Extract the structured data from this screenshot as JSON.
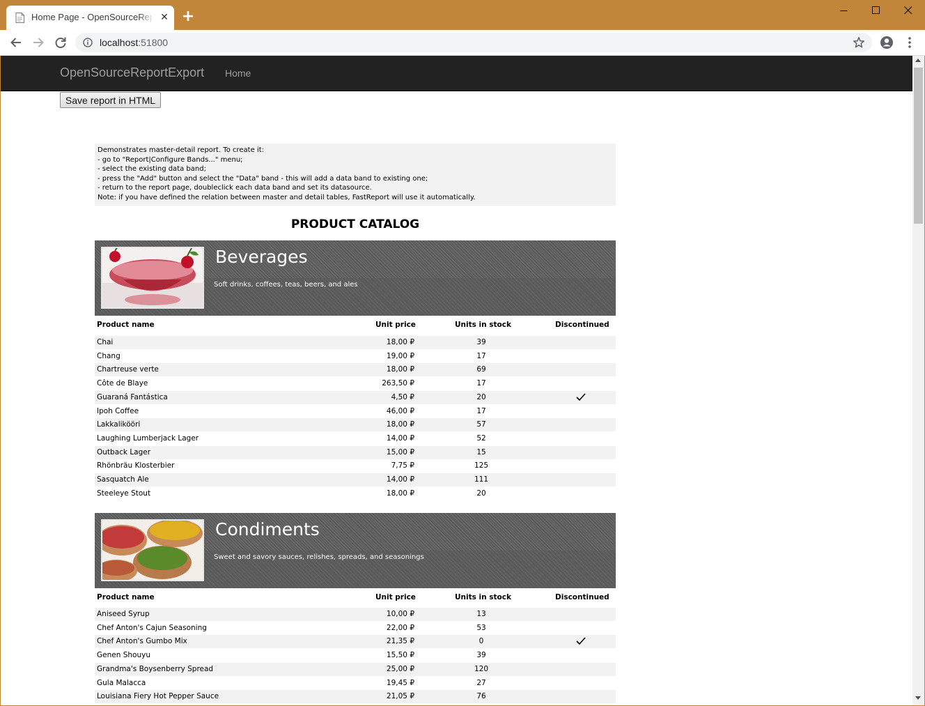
{
  "browser": {
    "tab_title": "Home Page - OpenSourceReportExport",
    "url_host": "localhost",
    "url_port": ":51800"
  },
  "navbar": {
    "brand": "OpenSourceReportExport",
    "home": "Home"
  },
  "save_button": "Save report in HTML",
  "report": {
    "description": [
      "Demonstrates master-detail report. To create it:",
      "- go to \"Report|Configure Bands...\" menu;",
      "- select the existing data band;",
      "- press the \"Add\" button and select the \"Data\" band - this will add a data band to existing one;",
      "- return to the report page, doubleclick each data band and set its datasource.",
      "Note: if you have defined the relation between master and detail tables, FastReport will use it automatically."
    ],
    "title": "PRODUCT CATALOG",
    "columns": {
      "name": "Product name",
      "price": "Unit price",
      "stock": "Units in stock",
      "discontinued": "Discontinued"
    },
    "categories": [
      {
        "name": "Beverages",
        "description": "Soft drinks, coffees, teas, beers, and ales",
        "image": "cocktail-glass-with-cherries",
        "products": [
          {
            "name": "Chai",
            "price": "18,00 ₽",
            "stock": "39",
            "discontinued": false
          },
          {
            "name": "Chang",
            "price": "19,00 ₽",
            "stock": "17",
            "discontinued": false
          },
          {
            "name": "Chartreuse verte",
            "price": "18,00 ₽",
            "stock": "69",
            "discontinued": false
          },
          {
            "name": "Côte de Blaye",
            "price": "263,50 ₽",
            "stock": "17",
            "discontinued": false
          },
          {
            "name": "Guaraná Fantástica",
            "price": "4,50 ₽",
            "stock": "20",
            "discontinued": true
          },
          {
            "name": "Ipoh Coffee",
            "price": "46,00 ₽",
            "stock": "17",
            "discontinued": false
          },
          {
            "name": "Lakkalikööri",
            "price": "18,00 ₽",
            "stock": "57",
            "discontinued": false
          },
          {
            "name": "Laughing Lumberjack Lager",
            "price": "14,00 ₽",
            "stock": "52",
            "discontinued": false
          },
          {
            "name": "Outback Lager",
            "price": "15,00 ₽",
            "stock": "15",
            "discontinued": false
          },
          {
            "name": "Rhönbräu Klosterbier",
            "price": "7,75 ₽",
            "stock": "125",
            "discontinued": false
          },
          {
            "name": "Sasquatch Ale",
            "price": "14,00 ₽",
            "stock": "111",
            "discontinued": false
          },
          {
            "name": "Steeleye Stout",
            "price": "18,00 ₽",
            "stock": "20",
            "discontinued": false
          }
        ]
      },
      {
        "name": "Condiments",
        "description": "Sweet and savory sauces, relishes, spreads, and seasonings",
        "image": "spice-bowls",
        "products": [
          {
            "name": "Aniseed Syrup",
            "price": "10,00 ₽",
            "stock": "13",
            "discontinued": false
          },
          {
            "name": "Chef Anton's Cajun Seasoning",
            "price": "22,00 ₽",
            "stock": "53",
            "discontinued": false
          },
          {
            "name": "Chef Anton's Gumbo Mix",
            "price": "21,35 ₽",
            "stock": "0",
            "discontinued": true
          },
          {
            "name": "Genen Shouyu",
            "price": "15,50 ₽",
            "stock": "39",
            "discontinued": false
          },
          {
            "name": "Grandma's Boysenberry Spread",
            "price": "25,00 ₽",
            "stock": "120",
            "discontinued": false
          },
          {
            "name": "Gula Malacca",
            "price": "19,45 ₽",
            "stock": "27",
            "discontinued": false
          },
          {
            "name": "Louisiana Fiery Hot Pepper Sauce",
            "price": "21,05 ₽",
            "stock": "76",
            "discontinued": false
          }
        ]
      }
    ]
  },
  "icons": {
    "back": "arrow-left-icon",
    "forward": "arrow-right-icon",
    "reload": "reload-icon",
    "info": "info-icon",
    "star": "star-icon",
    "account": "account-icon",
    "menu": "more-vert-icon",
    "check": "checkmark-icon"
  }
}
